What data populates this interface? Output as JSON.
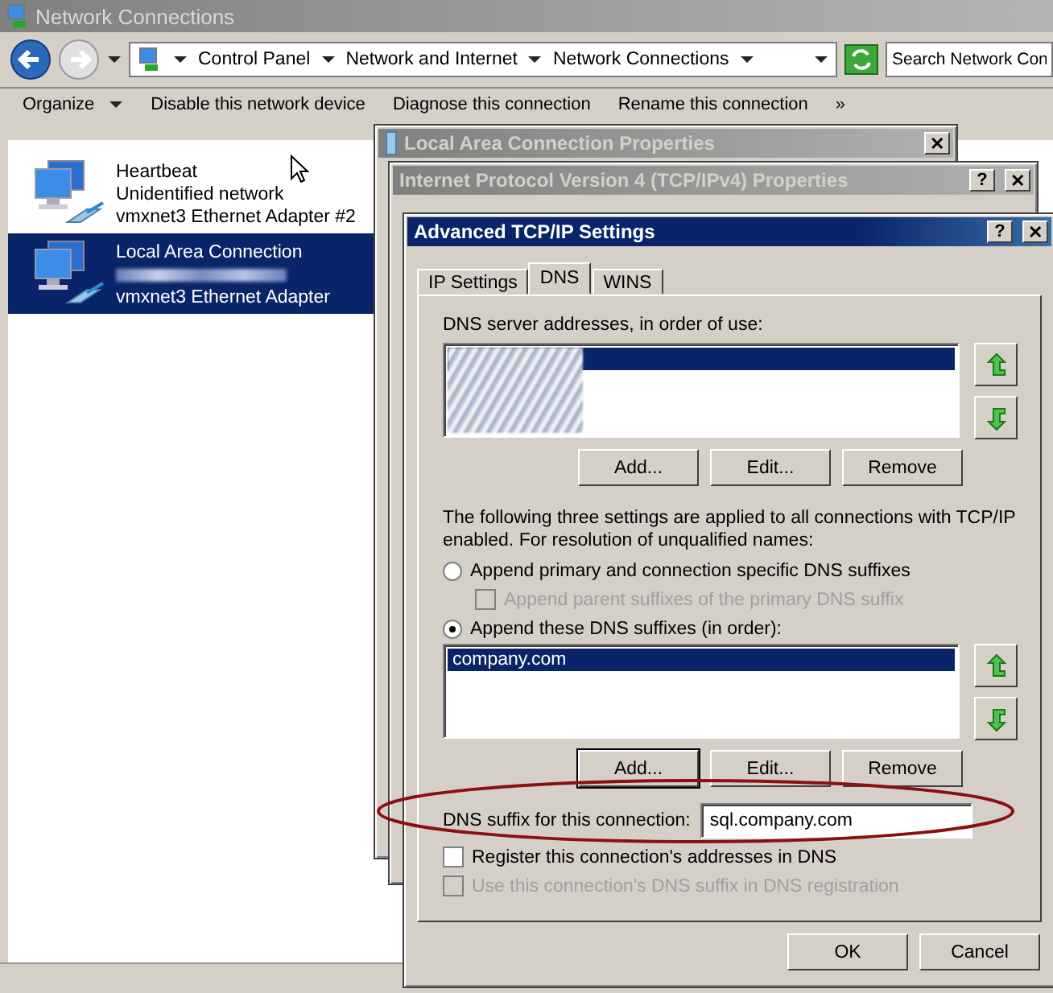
{
  "explorer": {
    "title": "Network Connections",
    "breadcrumbs": [
      "Control Panel",
      "Network and Internet",
      "Network Connections"
    ],
    "search_placeholder": "Search Network Con",
    "toolbar": [
      "Organize",
      "Disable this network device",
      "Diagnose this connection",
      "Rename this connection"
    ],
    "more": "»",
    "connections": [
      {
        "name": "Heartbeat",
        "status": "Unidentified network",
        "adapter": "vmxnet3 Ethernet Adapter #2",
        "selected": false
      },
      {
        "name": "Local Area Connection",
        "adapter": "vmxnet3 Ethernet Adapter",
        "selected": true
      }
    ]
  },
  "windows": [
    {
      "title": "Local Area Connection Properties",
      "title_buttons": [
        "✕"
      ]
    },
    {
      "title": "Internet Protocol Version 4 (TCP/IPv4) Properties",
      "title_buttons": [
        "?",
        "✕"
      ]
    }
  ],
  "dialog": {
    "title": "Advanced TCP/IP Settings",
    "title_buttons": [
      "?",
      "✕"
    ],
    "tabs": [
      {
        "label": "IP Settings",
        "selected": false
      },
      {
        "label": "DNS",
        "selected": true
      },
      {
        "label": "WINS",
        "selected": false
      }
    ],
    "servers_label": "DNS server addresses, in order of use:",
    "servers": [
      {
        "selected": true
      }
    ],
    "server_buttons": [
      {
        "label": "Add...",
        "default": false
      },
      {
        "label": "Edit...",
        "default": false
      },
      {
        "label": "Remove",
        "default": false
      }
    ],
    "note": "The following three settings are applied to all connections with TCP/IP enabled. For resolution of unqualified names:",
    "options": [
      {
        "kind": "radio",
        "label": "Append primary and connection specific DNS suffixes",
        "selected": false,
        "disabled": false
      },
      {
        "kind": "checkbox",
        "label": "Append parent suffixes of the primary DNS suffix",
        "checked": false,
        "disabled": true
      },
      {
        "kind": "radio",
        "label": "Append these DNS suffixes (in order):",
        "selected": true,
        "disabled": false
      }
    ],
    "suffixes": [
      {
        "text": "company.com",
        "selected": true
      }
    ],
    "suffix_buttons": [
      {
        "label": "Add...",
        "default": true
      },
      {
        "label": "Edit...",
        "default": false
      },
      {
        "label": "Remove",
        "default": false
      }
    ],
    "connection_suffix": {
      "label": "DNS suffix for this connection:",
      "value": "sql.company.com"
    },
    "register": [
      {
        "label": "Register this connection's addresses in DNS",
        "checked": false,
        "disabled": false
      },
      {
        "label": "Use this connection's DNS suffix in DNS registration",
        "checked": false,
        "disabled": true
      }
    ],
    "footer_buttons": [
      "OK",
      "Cancel"
    ]
  }
}
